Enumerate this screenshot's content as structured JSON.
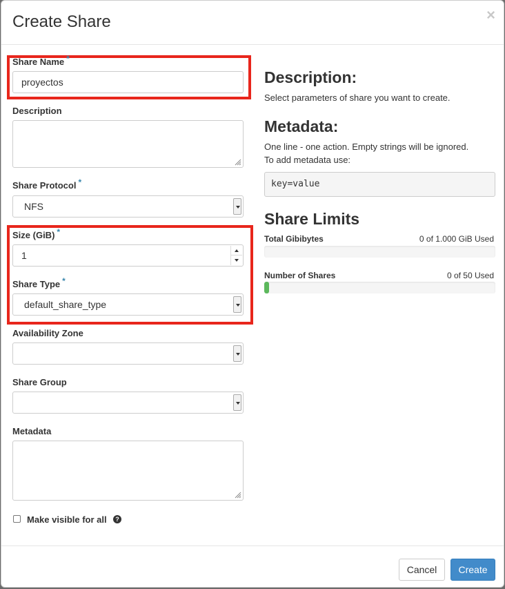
{
  "dialog": {
    "title": "Create Share",
    "close_symbol": "×"
  },
  "form": {
    "share_name": {
      "label": "Share Name",
      "value": "proyectos",
      "required_marker": "*"
    },
    "description": {
      "label": "Description",
      "value": ""
    },
    "share_protocol": {
      "label": "Share Protocol",
      "value": "NFS",
      "required_marker": "*"
    },
    "size": {
      "label": "Size (GiB)",
      "value": "1",
      "required_marker": "*"
    },
    "share_type": {
      "label": "Share Type",
      "value": "default_share_type",
      "required_marker": "*"
    },
    "availability_zone": {
      "label": "Availability Zone",
      "value": ""
    },
    "share_group": {
      "label": "Share Group",
      "value": ""
    },
    "metadata": {
      "label": "Metadata",
      "value": ""
    },
    "make_visible": {
      "label": "Make visible for all",
      "checked": false,
      "help_symbol": "?"
    }
  },
  "help_panel": {
    "description_heading": "Description:",
    "description_text": "Select parameters of share you want to create.",
    "metadata_heading": "Metadata:",
    "metadata_text_1": "One line - one action. Empty strings will be ignored.",
    "metadata_text_2": "To add metadata use:",
    "metadata_example": "key=value",
    "limits_heading": "Share Limits"
  },
  "quotas": {
    "total_gibibytes": {
      "label": "Total Gibibytes",
      "value": "0 of 1.000 GiB Used",
      "fraction": 0
    },
    "number_of_shares": {
      "label": "Number of Shares",
      "value": "0 of 50 Used",
      "fraction": 0.02
    }
  },
  "footer": {
    "cancel_label": "Cancel",
    "create_label": "Create"
  },
  "colors": {
    "primary": "#428bca",
    "highlight": "#e8261c",
    "progress": "#5cb85c",
    "required": "#3a87ad"
  }
}
